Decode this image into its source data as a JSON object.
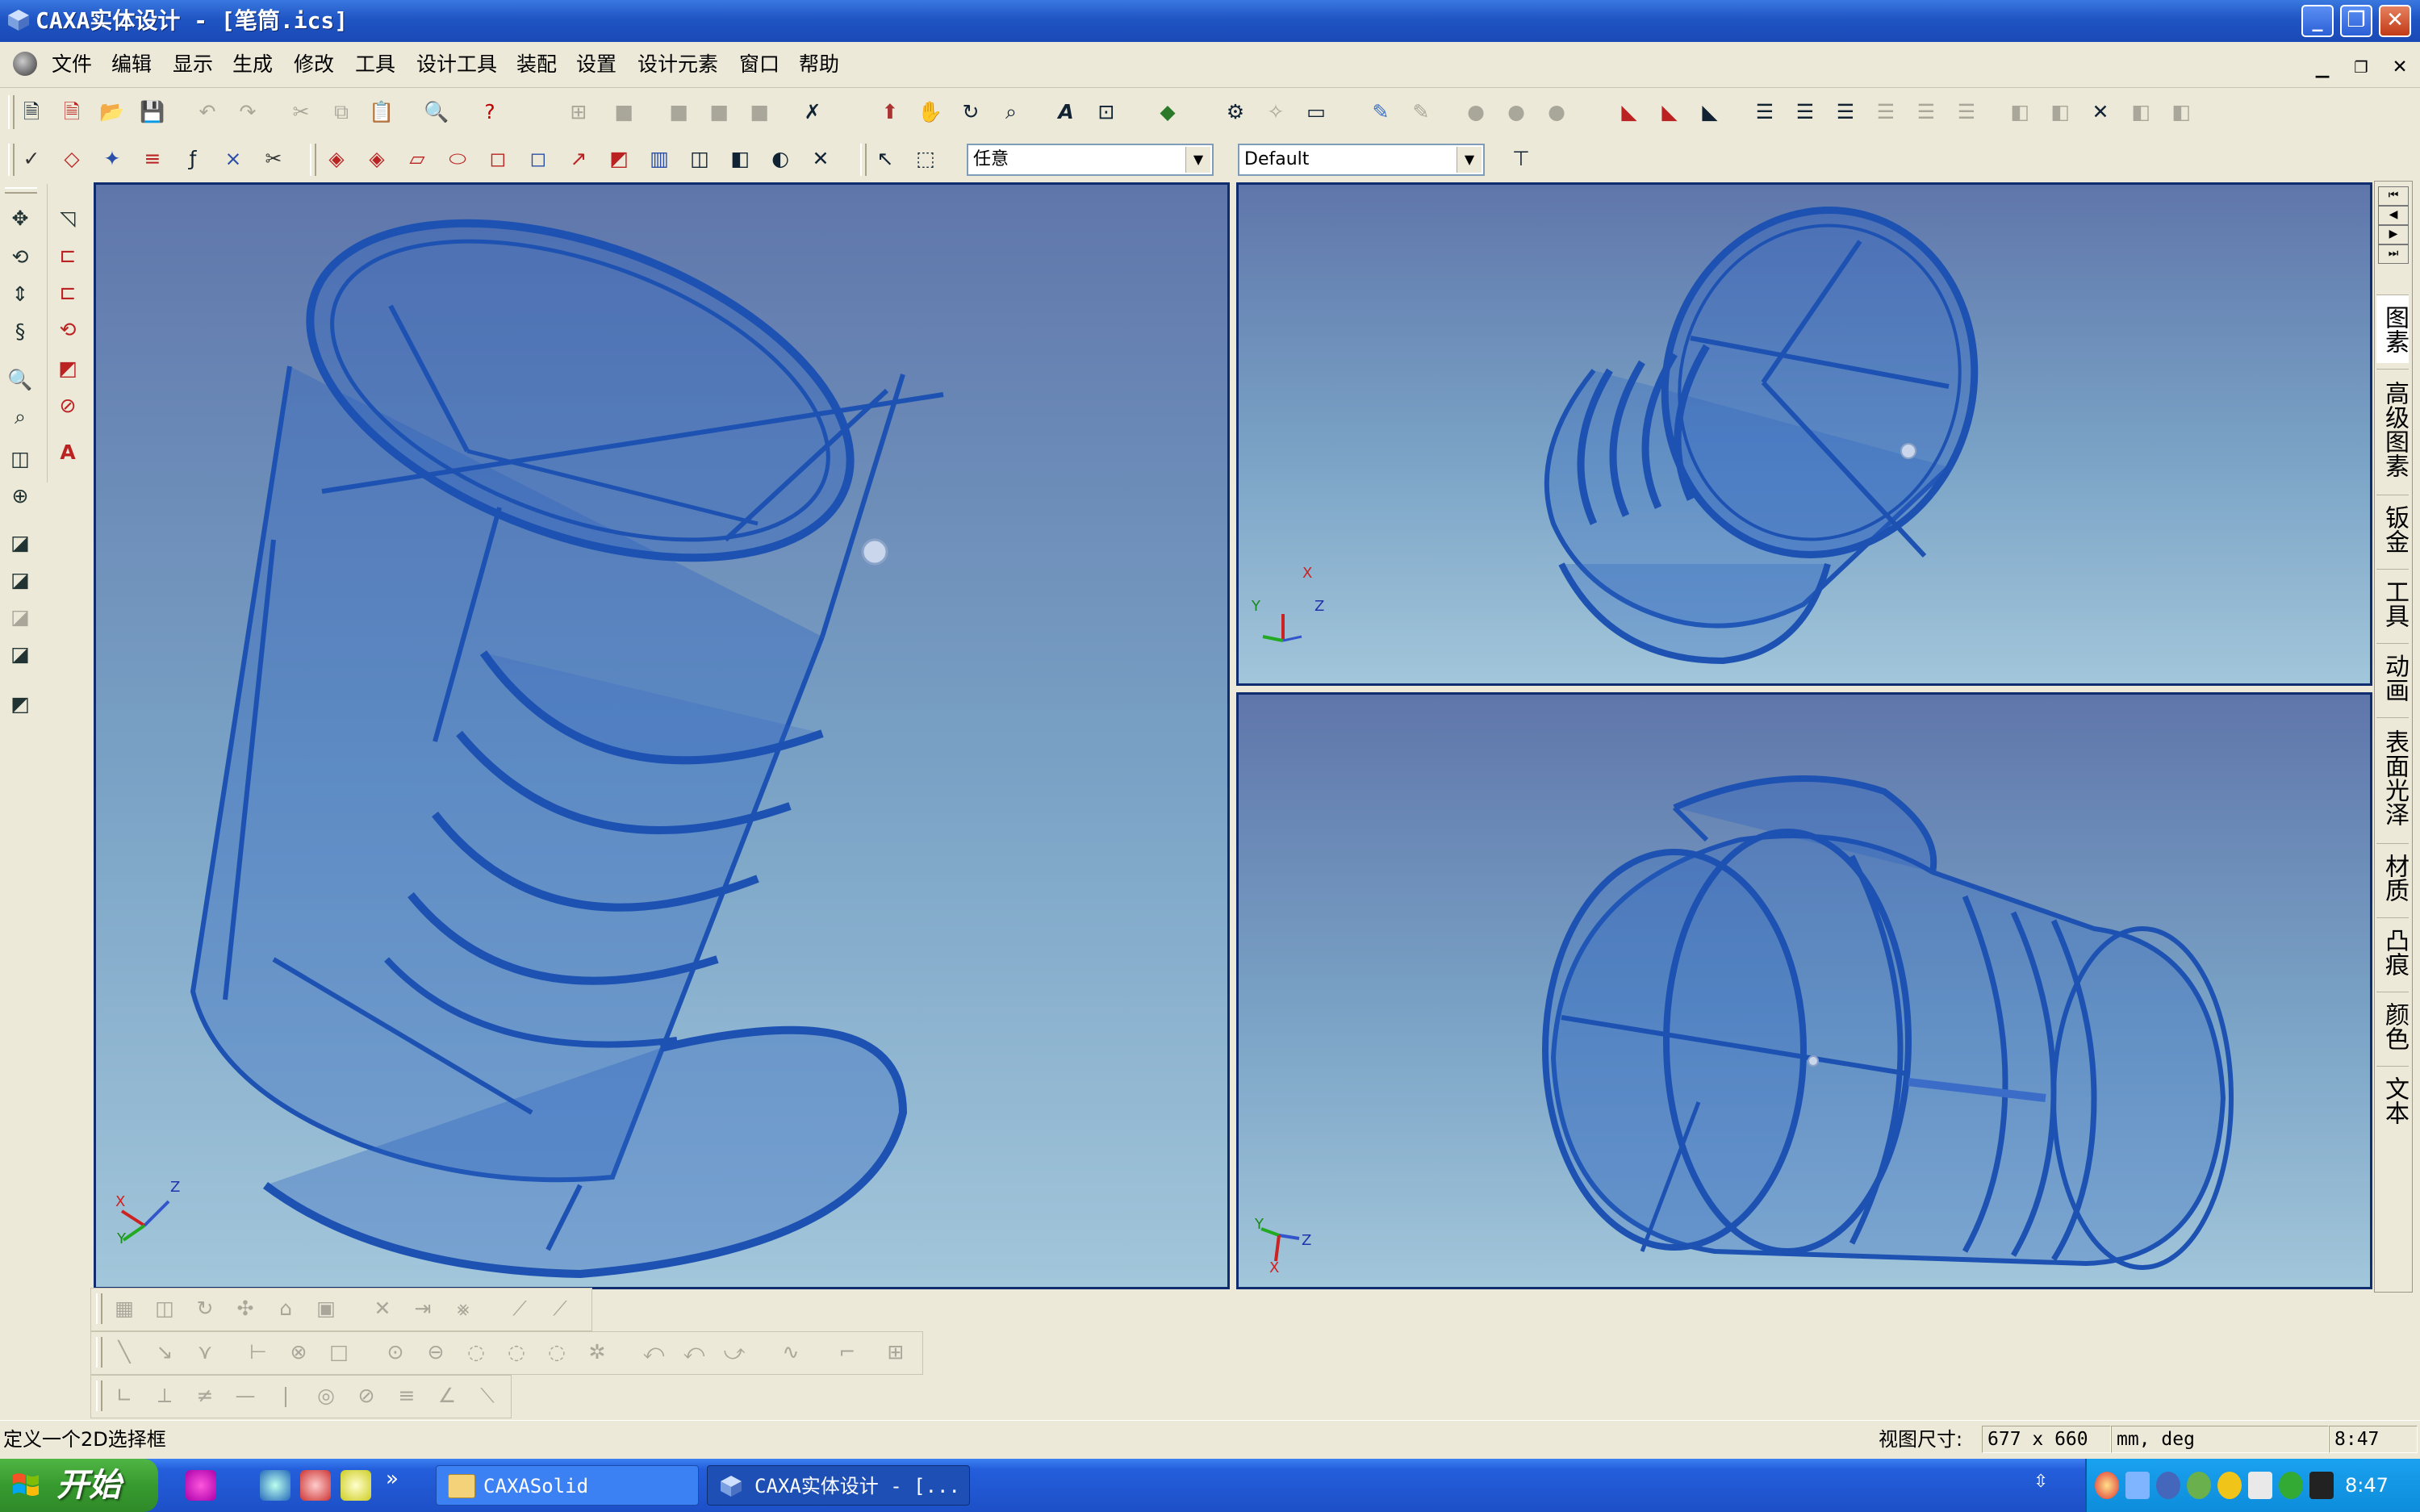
{
  "window": {
    "title": "CAXA实体设计 - [笔筒.ics]",
    "controls": [
      "_",
      "❐",
      "✕"
    ]
  },
  "menu": {
    "items": [
      "文件",
      "编辑",
      "显示",
      "生成",
      "修改",
      "工具",
      "设计工具",
      "装配",
      "设置",
      "设计元素",
      "窗口",
      "帮助"
    ],
    "mdi_controls": [
      "_",
      "❐",
      "✕"
    ]
  },
  "toolbar": {
    "selection_filter": "任意",
    "scheme": "Default"
  },
  "views": {
    "main_axes": {
      "x": "X",
      "y": "Y",
      "z": "Z"
    },
    "top_right_axes": {
      "x": "X",
      "y": "Y",
      "z": "Z"
    },
    "bottom_right_axes": {
      "x": "X",
      "y": "Y",
      "z": "Z"
    }
  },
  "right_tabs": [
    "图素",
    "高级图素",
    "钣金",
    "工具",
    "动画",
    "表面光泽",
    "材质",
    "凸痕",
    "颜色",
    "文本"
  ],
  "status": {
    "message": "定义一个2D选择框",
    "view_size_label": "视图尺寸:",
    "view_size_value": "677 x  660",
    "units": "mm, deg",
    "coord": "8:47"
  },
  "taskbar": {
    "start_label": "开始",
    "quick_more": "»",
    "tasks": [
      {
        "label": "CAXASolid",
        "active": false
      },
      {
        "label": "CAXA实体设计 - [...",
        "active": true
      }
    ],
    "tray_time": "8:47"
  },
  "colors": {
    "titlebar": "#1f55c4",
    "viewport_top": "#5f76ab",
    "viewport_bottom": "#a2c6da",
    "part_blue": "#2f65c2",
    "taskbar": "#245edb",
    "start_green": "#379a2f"
  }
}
